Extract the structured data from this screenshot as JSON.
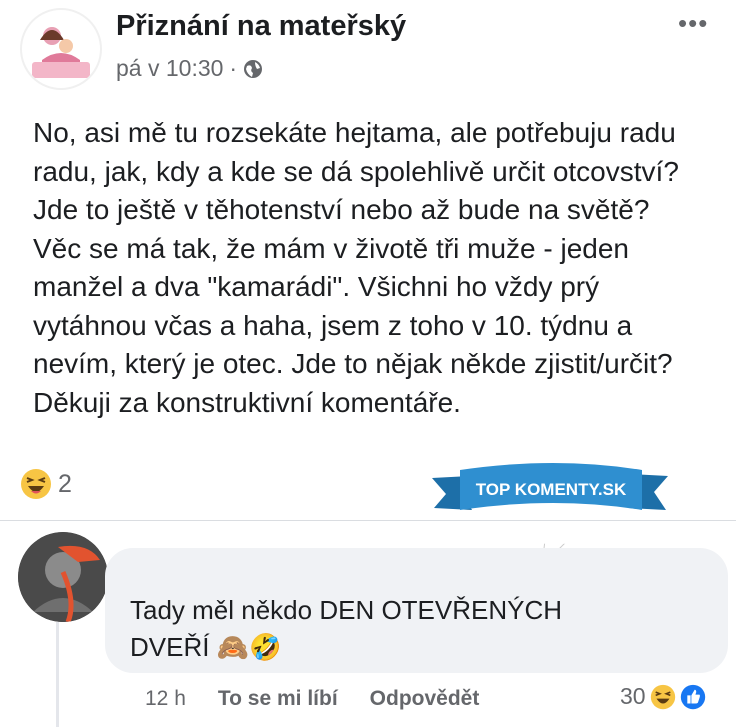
{
  "post": {
    "page_name": "Přiznání na mateřský",
    "time": "pá v 10:30",
    "separator": "·",
    "text": "No, asi mě tu rozsekáte hejtama, ale potřebuju radu\nradu, jak, kdy a kde se dá spolehlivě určit otcovství?\nJde to ještě v těhotenství nebo až bude na světě?\nVěc se má tak, že mám v životě tři muže - jeden\nmanžel a dva \"kamarádi\". Všichni ho vždy prý\nvytáhnou včas a haha, jsem z toho v 10. týdnu a\nnevím, který je otec. Jde to nějak někde zjistit/určit?\nDěkuji za konstruktivní komentáře.",
    "more_label": "•••",
    "reaction_count": "2"
  },
  "comment": {
    "text": "Tady měl někdo DEN OTEVŘENÝCH\nDVEŘÍ",
    "emojis": "🙈🤣",
    "time": "12 h",
    "like_label": "To se mi líbí",
    "reply_label": "Odpovědět",
    "reaction_count": "30"
  },
  "watermark": {
    "text": "TOP KOMENTY.SK"
  },
  "colors": {
    "text": "#1c1e21",
    "secondary": "#65676b",
    "bubble": "#f0f2f5",
    "banner": "#2f8fd0",
    "like_blue": "#1877f2",
    "haha_yellow": "#f7c544"
  },
  "icons": [
    "globe-icon",
    "haha-emoji-icon",
    "like-icon",
    "more-icon"
  ]
}
